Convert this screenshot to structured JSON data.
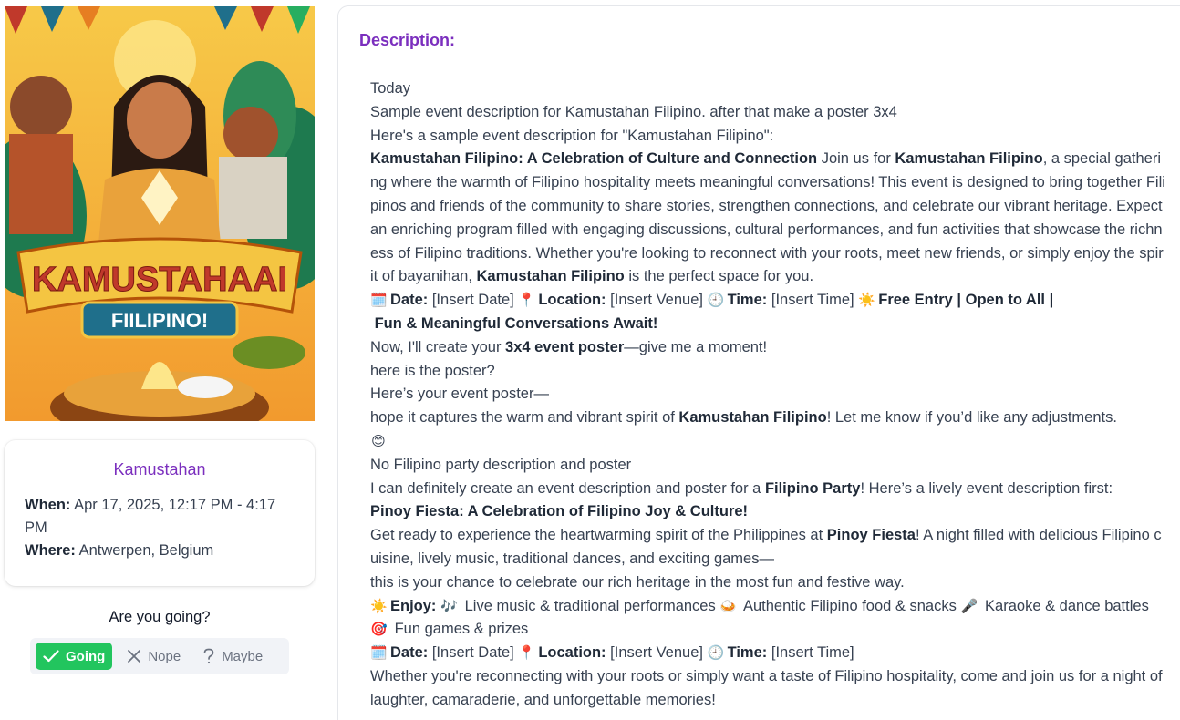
{
  "poster": {
    "headline": "KAMUSTAHAAI",
    "subline": "FIILIPINO!"
  },
  "event": {
    "title": "Kamustahan",
    "when_label": "When:",
    "when_value": "Apr 17, 2025, 12:17 PM - 4:17 PM",
    "where_label": "Where:",
    "where_value": "Antwerpen, Belgium"
  },
  "rsvp": {
    "question": "Are you going?",
    "going": "Going",
    "nope": "Nope",
    "maybe": "Maybe"
  },
  "description": {
    "heading": "Description:",
    "l1": "Today",
    "l2": "Sample event description for Kamustahan Filipino. after that make a poster 3x4",
    "l3": "Here's a sample event description for \"Kamustahan Filipino\":",
    "p1_bold": "Kamustahan Filipino: A Celebration of Culture and Connection",
    "p1_a": " Join us for ",
    "p1_bold2": "Kamustahan Filipino",
    "p1_b": ", a special gathering where the warmth of Filipino hospitality meets meaningful conversations! This event is designed to bring together Filipinos and friends of the community to share stories, strengthen connections, and celebrate our vibrant heritage. Expect an enriching program filled with engaging discussions, cultural performances, and fun activities that showcase the richness of Filipino traditions. Whether you're looking to reconnect with your roots, meet new friends, or simply enjoy the spirit of bayanihan, ",
    "p1_bold3": "Kamustahan Filipino",
    "p1_c": " is the perfect space for you.",
    "date_label": "Date:",
    "date_value": " [Insert Date] ",
    "location_label": "Location:",
    "location_value": " [Insert Venue] ",
    "time_label": "Time:",
    "time_value": " [Insert Time] ",
    "free_entry": "Free Entry | Open to All |",
    "fun": "Fun & Meaningful Conversations Await!",
    "now_a": "Now, I'll create your ",
    "now_bold": "3x4 event poster",
    "now_b": "—give me a moment!",
    "here_poster": "here is the poster?",
    "heres_your": "Here’s your event poster—",
    "hope_a": "hope it captures the warm and vibrant spirit of ",
    "hope_bold": "Kamustahan Filipino",
    "hope_b": "! Let me know if you’d like any adjustments.",
    "no_party": "No Filipino party description and poster",
    "can_a": "I can definitely create an event description and poster for a ",
    "can_bold": "Filipino Party",
    "can_b": "! Here’s a lively event description first:",
    "pinoy_title": "Pinoy Fiesta: A Celebration of Filipino Joy & Culture!",
    "ready_a": "Get ready to experience the heartwarming spirit of the Philippines at ",
    "ready_bold": "Pinoy Fiesta",
    "ready_b": "! A night filled with delicious Filipino cuisine, lively music, traditional dances, and exciting games—",
    "chance": "this is your chance to celebrate our rich heritage in the most fun and festive way.",
    "enjoy_label": "Enjoy:",
    "enjoy_1": " Live music & traditional performances ",
    "enjoy_2": " Authentic Filipino food & snacks ",
    "enjoy_3": " Karaoke & dance battles ",
    "enjoy_4": " Fun games & prizes",
    "whether": "Whether you're reconnecting with your roots or simply want a taste of Filipino hospitality, come and join us for a night of laughter, camaraderie, and unforgettable memories!"
  },
  "icons": {
    "calendar": "🗓️",
    "pin": "📍",
    "clock": "🕘",
    "sun": "☀️",
    "smile": "😊",
    "music": "🎶",
    "food": "🍛",
    "mic": "🎤",
    "target": "🎯"
  },
  "colors": {
    "accent_purple": "#7b2fbe",
    "going_green": "#22c55e"
  }
}
